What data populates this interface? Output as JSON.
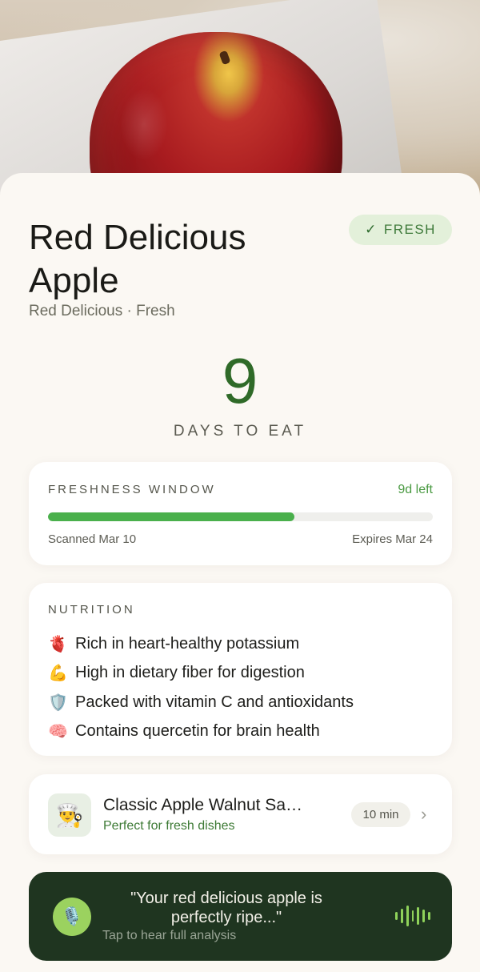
{
  "product": {
    "name": "Red Delicious Apple",
    "subtitle": "Red Delicious · Fresh",
    "status_badge": "FRESH",
    "status_icon": "check-icon"
  },
  "countdown": {
    "days": "9",
    "label": "DAYS TO EAT"
  },
  "freshness": {
    "label": "FRESHNESS WINDOW",
    "days_left": "9d left",
    "progress_fraction": 0.64,
    "scanned": "Scanned Mar 10",
    "expires": "Expires Mar 24"
  },
  "nutrition": {
    "label": "NUTRITION",
    "items": [
      {
        "icon": "🫀",
        "text": "Rich in heart-healthy potassium"
      },
      {
        "icon": "💪",
        "text": "High in dietary fiber for digestion"
      },
      {
        "icon": "🛡️",
        "text": "Packed with vitamin C and antioxidants"
      },
      {
        "icon": "🧠",
        "text": "Contains quercetin for brain health"
      }
    ]
  },
  "recipe": {
    "icon": "👨‍🍳",
    "title": "Classic Apple Walnut Sa…",
    "subtitle": "Perfect for fresh dishes",
    "time": "10 min"
  },
  "audio": {
    "icon": "🎙️",
    "quote": "\"Your red delicious apple is perfectly ripe...\"",
    "cta": "Tap to hear full analysis"
  },
  "colors": {
    "accent_green": "#4ab04c",
    "dark_green": "#1f3520",
    "badge_bg": "#e3f0da"
  }
}
